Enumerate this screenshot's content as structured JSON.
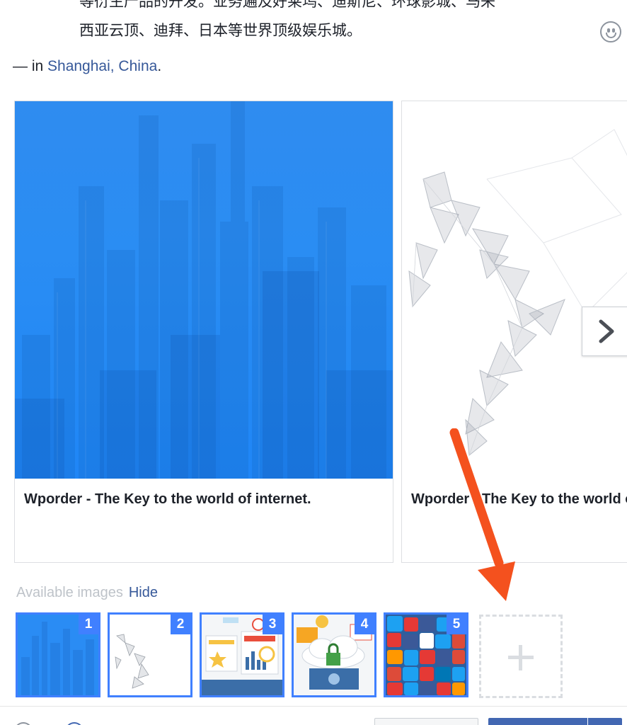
{
  "post": {
    "text_line1": "等衍生产品的开发。业务遍及好莱坞、迪斯尼、环球影城、马来",
    "text_line2": "西亚云顶、迪拜、日本等世界顶级娱乐城。"
  },
  "location": {
    "prefix": "— in ",
    "place": "Shanghai, China",
    "suffix": "."
  },
  "carousel": {
    "cards": [
      {
        "title": "Wporder - The Key to the world of internet.",
        "image": "city-skyline-blue"
      },
      {
        "title": "Wporder - The Key to the world of internet.",
        "image": "polygon-network-figure"
      }
    ],
    "next_icon": "chevron-right-icon"
  },
  "available_images": {
    "label": "Available images",
    "hide_label": "Hide",
    "thumbnails": [
      {
        "number": "1",
        "image": "city-skyline-blue",
        "selected": true
      },
      {
        "number": "2",
        "image": "polygon-network-figure",
        "selected": false
      },
      {
        "number": "3",
        "image": "web-design-illustration",
        "selected": false
      },
      {
        "number": "4",
        "image": "cloud-security-illustration",
        "selected": false
      },
      {
        "number": "5",
        "image": "social-media-icons-collage",
        "selected": false
      }
    ],
    "add_icon": "plus-icon"
  },
  "colors": {
    "link": "#365899",
    "selection": "#4080ff",
    "primary_button": "#4267b2",
    "annotation_arrow": "#f4511e"
  }
}
